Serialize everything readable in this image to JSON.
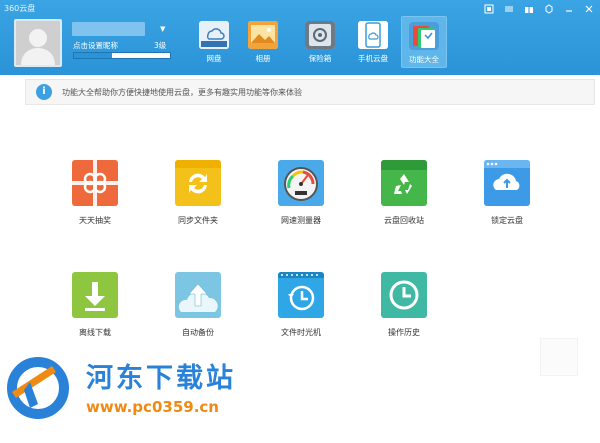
{
  "window": {
    "title": "360云盘"
  },
  "user": {
    "set_nickname": "点击设置昵称",
    "level": "3级",
    "progress": 0.4
  },
  "nav": {
    "tabs": [
      {
        "label": "网盘",
        "icon": "cloud-drive-icon"
      },
      {
        "label": "相册",
        "icon": "photo-album-icon"
      },
      {
        "label": "保险箱",
        "icon": "safe-box-icon"
      },
      {
        "label": "手机云盘",
        "icon": "mobile-cloud-icon"
      },
      {
        "label": "功能大全",
        "icon": "all-features-icon",
        "active": true
      }
    ]
  },
  "info": {
    "text": "功能大全帮助你方便快捷地使用云盘，更多有趣实用功能等你来体验"
  },
  "features": [
    {
      "label": "天天抽奖",
      "icon": "gift-icon",
      "color": "#ee6a3c"
    },
    {
      "label": "同步文件夹",
      "icon": "sync-folder-icon",
      "color": "#f4c01a"
    },
    {
      "label": "网速测量器",
      "icon": "speedometer-icon",
      "color": "#4aa9e8"
    },
    {
      "label": "云盘回收站",
      "icon": "recycle-bin-icon",
      "color": "#45b649"
    },
    {
      "label": "锁定云盘",
      "icon": "cloud-lock-icon",
      "color": "#3c9ae6"
    },
    {
      "label": "离线下载",
      "icon": "offline-download-icon",
      "color": "#8ec63f"
    },
    {
      "label": "自动备份",
      "icon": "auto-backup-icon",
      "color": "#7cc6e3"
    },
    {
      "label": "文件时光机",
      "icon": "file-time-machine-icon",
      "color": "#2fa6e6"
    },
    {
      "label": "操作历史",
      "icon": "operation-history-icon",
      "color": "#3fb9a4"
    }
  ],
  "watermark": {
    "title": "河东下载站",
    "url": "www.pc0359.cn"
  }
}
